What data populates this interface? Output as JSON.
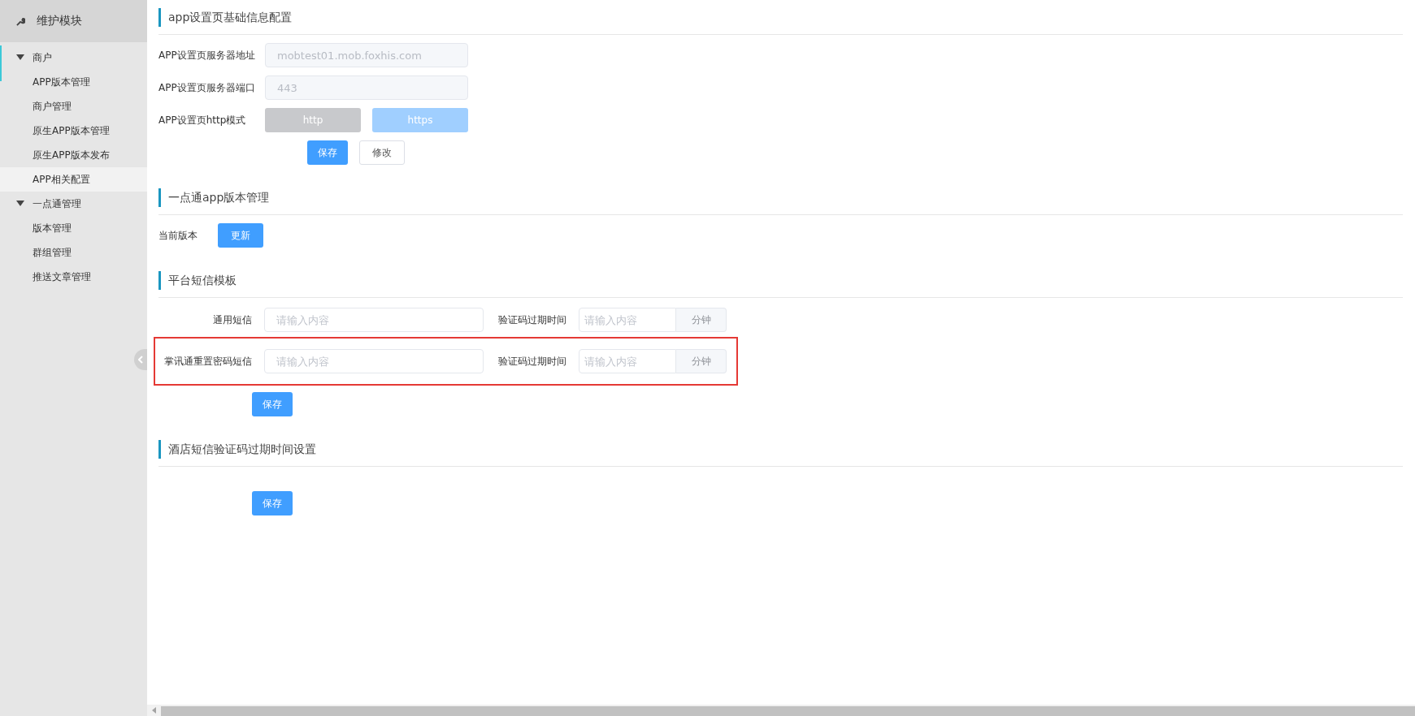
{
  "sidebar": {
    "title": "维护模块",
    "groups": [
      {
        "label": "商户",
        "expanded": true,
        "items": [
          {
            "label": "APP版本管理",
            "selected": false
          },
          {
            "label": "商户管理",
            "selected": false
          },
          {
            "label": "原生APP版本管理",
            "selected": false
          },
          {
            "label": "原生APP版本发布",
            "selected": false
          },
          {
            "label": "APP相关配置",
            "selected": true
          }
        ]
      },
      {
        "label": "一点通管理",
        "expanded": true,
        "items": [
          {
            "label": "版本管理",
            "selected": false
          },
          {
            "label": "群组管理",
            "selected": false
          },
          {
            "label": "推送文章管理",
            "selected": false
          }
        ]
      }
    ]
  },
  "app_settings": {
    "title": "app设置页基础信息配置",
    "fields": [
      {
        "label": "APP设置页服务器地址",
        "value": "mobtest01.mob.foxhis.com",
        "disabled": true
      },
      {
        "label": "APP设置页服务器端口",
        "value": "443",
        "disabled": true
      }
    ],
    "mode": {
      "label": "APP设置页http模式",
      "options": [
        {
          "label": "http",
          "kind": "neutral",
          "disabled": true
        },
        {
          "label": "https",
          "kind": "primary",
          "disabled": true
        }
      ]
    },
    "buttons": [
      {
        "label": "保存",
        "kind": "primary"
      },
      {
        "label": "修改",
        "kind": "default"
      }
    ]
  },
  "version": {
    "title": "一点通app版本管理",
    "label": "当前版本",
    "button": {
      "label": "更新",
      "kind": "primary"
    }
  },
  "sms_templates": {
    "title": "平台短信模板",
    "rows": [
      {
        "label": "通用短信",
        "placeholder": "请输入内容",
        "expiry_label": "验证码过期时间",
        "expiry_placeholder": "请输入内容",
        "unit": "分钟",
        "highlighted": false
      },
      {
        "label": "掌讯通重置密码短信",
        "placeholder": "请输入内容",
        "expiry_label": "验证码过期时间",
        "expiry_placeholder": "请输入内容",
        "unit": "分钟",
        "highlighted": true
      }
    ],
    "button": {
      "label": "保存",
      "kind": "primary"
    }
  },
  "hotel_sms": {
    "title": "酒店短信验证码过期时间设置",
    "button": {
      "label": "保存",
      "kind": "primary"
    }
  }
}
